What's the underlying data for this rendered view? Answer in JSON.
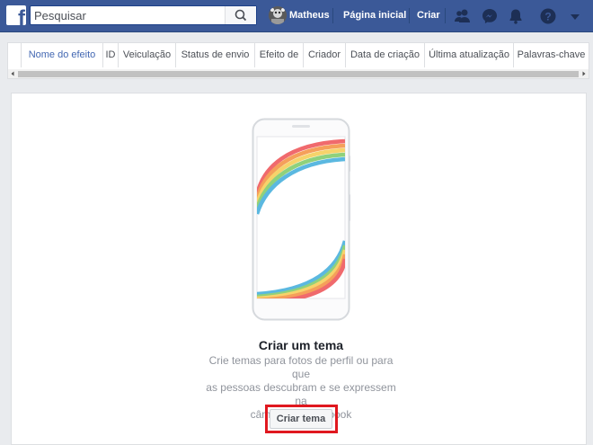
{
  "header": {
    "search": {
      "placeholder": "Pesquisar"
    },
    "user_name": "Matheus",
    "home_label": "Página inicial",
    "create_label": "Criar",
    "colors": {
      "bar": "#3b5998"
    },
    "icons": [
      "facebook-logo",
      "search-icon",
      "friends-icon",
      "messenger-icon",
      "notifications-bell-icon",
      "help-icon",
      "dropdown-arrow-icon"
    ]
  },
  "table": {
    "columns": [
      "Nome do efeito",
      "ID",
      "Veiculação",
      "Status de envio",
      "Efeito de",
      "Criador",
      "Data de criação",
      "Última atualização",
      "Palavras-chave"
    ],
    "active_column": "Nome do efeito"
  },
  "empty_state": {
    "title": "Criar um tema",
    "description_lines": [
      "Crie temas para fotos de perfil ou para que",
      "as pessoas descubram e se expressem na",
      "câmera do Facebook"
    ],
    "button_label": "Criar tema",
    "highlight_color": "#e0181f",
    "rainbow_colors": [
      "#f06a6d",
      "#f5a05a",
      "#f6d36b",
      "#8fd17c",
      "#5bb8e0"
    ]
  }
}
